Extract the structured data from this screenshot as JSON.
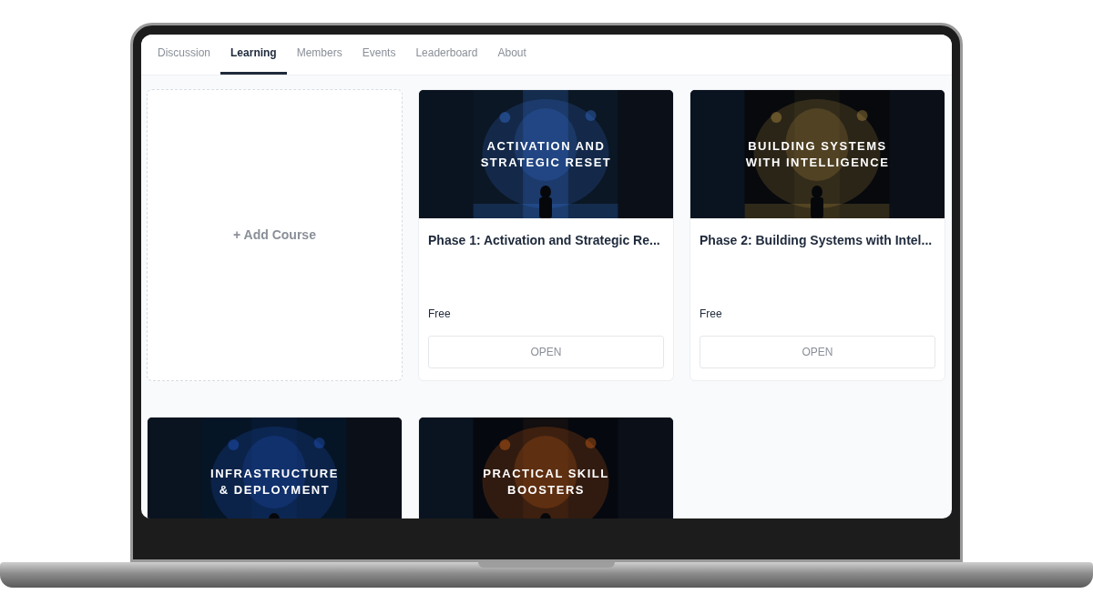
{
  "tabs": [
    {
      "label": "Discussion",
      "selected": false
    },
    {
      "label": "Learning",
      "selected": true
    },
    {
      "label": "Members",
      "selected": false
    },
    {
      "label": "Events",
      "selected": false
    },
    {
      "label": "Leaderboard",
      "selected": false
    },
    {
      "label": "About",
      "selected": false
    }
  ],
  "add_course": {
    "label": "+ Add Course"
  },
  "courses": [
    {
      "cover_lines": [
        "ACTIVATION AND",
        "STRATEGIC RESET"
      ],
      "title": "Phase 1: Activation and Strategic Re...",
      "price": "Free",
      "button": "OPEN"
    },
    {
      "cover_lines": [
        "BUILDING SYSTEMS",
        "WITH INTELLIGENCE"
      ],
      "title": "Phase 2: Building Systems with Intel...",
      "price": "Free",
      "button": "OPEN"
    },
    {
      "cover_lines": [
        "INFRASTRUCTURE",
        "& DEPLOYMENT"
      ]
    },
    {
      "cover_lines": [
        "PRACTICAL SKILL",
        "BOOSTERS"
      ]
    }
  ]
}
